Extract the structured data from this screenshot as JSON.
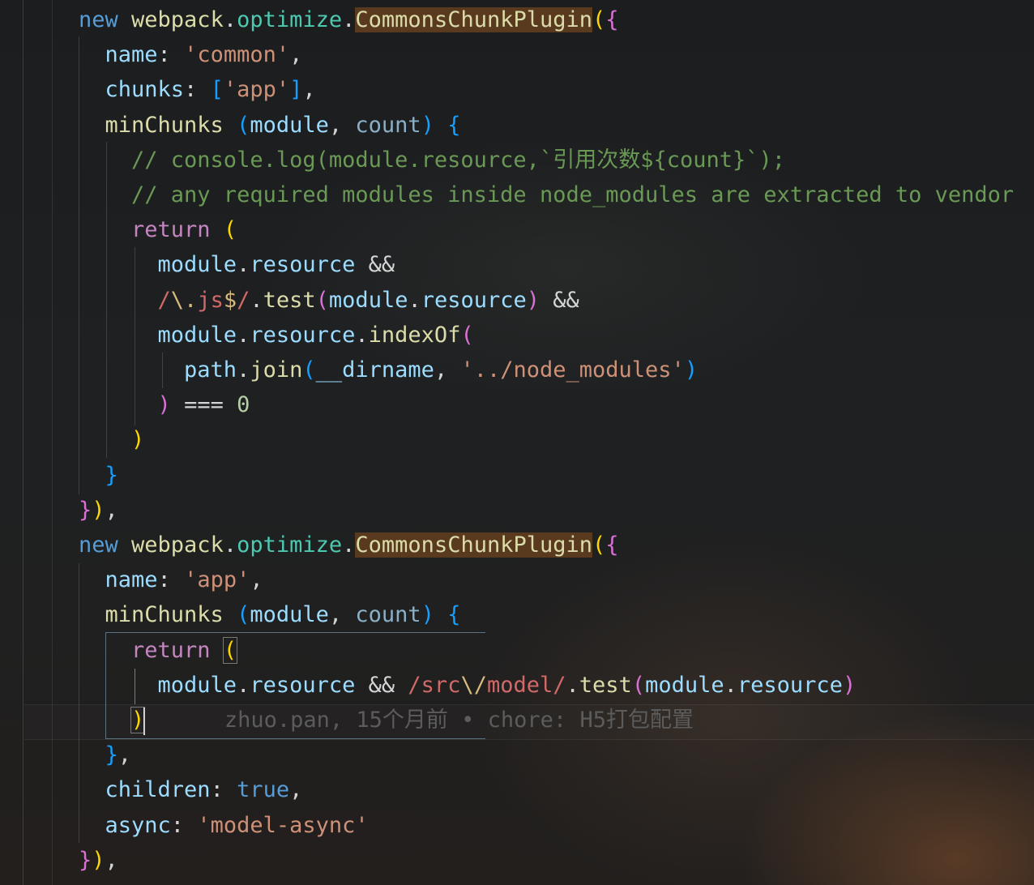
{
  "editor": {
    "language": "javascript",
    "lines": [
      [
        {
          "t": "new ",
          "c": "kw"
        },
        {
          "t": "webpack",
          "c": "fn"
        },
        {
          "t": ".",
          "c": "punc"
        },
        {
          "t": "optimize",
          "c": "cls"
        },
        {
          "t": ".",
          "c": "punc"
        },
        {
          "t": "CommonsChunkPlugin",
          "c": "fn hl"
        },
        {
          "t": "(",
          "c": "b1"
        },
        {
          "t": "{",
          "c": "b2"
        }
      ],
      [
        {
          "t": "  name",
          "c": "var"
        },
        {
          "t": ": ",
          "c": "punc"
        },
        {
          "t": "'common'",
          "c": "str"
        },
        {
          "t": ",",
          "c": "punc"
        }
      ],
      [
        {
          "t": "  chunks",
          "c": "var"
        },
        {
          "t": ": ",
          "c": "punc"
        },
        {
          "t": "[",
          "c": "b3"
        },
        {
          "t": "'app'",
          "c": "str"
        },
        {
          "t": "]",
          "c": "b3"
        },
        {
          "t": ",",
          "c": "punc"
        }
      ],
      [
        {
          "t": "  minChunks ",
          "c": "fn"
        },
        {
          "t": "(",
          "c": "b3"
        },
        {
          "t": "module",
          "c": "var"
        },
        {
          "t": ", ",
          "c": "punc"
        },
        {
          "t": "count",
          "c": "var-dim"
        },
        {
          "t": ") ",
          "c": "b3"
        },
        {
          "t": "{",
          "c": "b3"
        }
      ],
      [
        {
          "t": "    // console.log(module.resource,`引用次数${count}`);",
          "c": "cmt"
        }
      ],
      [
        {
          "t": "    // any required modules inside node_modules are extracted to vendor",
          "c": "cmt"
        }
      ],
      [
        {
          "t": "    return ",
          "c": "ctrl"
        },
        {
          "t": "(",
          "c": "b1"
        }
      ],
      [
        {
          "t": "      module",
          "c": "var"
        },
        {
          "t": ".",
          "c": "punc"
        },
        {
          "t": "resource",
          "c": "var"
        },
        {
          "t": " &&",
          "c": "punc"
        }
      ],
      [
        {
          "t": "      /",
          "c": "re"
        },
        {
          "t": "\\.",
          "c": "re-ch"
        },
        {
          "t": "js",
          "c": "re"
        },
        {
          "t": "$",
          "c": "re-ch"
        },
        {
          "t": "/",
          "c": "re"
        },
        {
          "t": ".",
          "c": "punc"
        },
        {
          "t": "test",
          "c": "fn"
        },
        {
          "t": "(",
          "c": "b2"
        },
        {
          "t": "module",
          "c": "var"
        },
        {
          "t": ".",
          "c": "punc"
        },
        {
          "t": "resource",
          "c": "var"
        },
        {
          "t": ")",
          "c": "b2"
        },
        {
          "t": " &&",
          "c": "punc"
        }
      ],
      [
        {
          "t": "      module",
          "c": "var"
        },
        {
          "t": ".",
          "c": "punc"
        },
        {
          "t": "resource",
          "c": "var"
        },
        {
          "t": ".",
          "c": "punc"
        },
        {
          "t": "indexOf",
          "c": "fn"
        },
        {
          "t": "(",
          "c": "b2"
        }
      ],
      [
        {
          "t": "        path",
          "c": "var"
        },
        {
          "t": ".",
          "c": "punc"
        },
        {
          "t": "join",
          "c": "fn"
        },
        {
          "t": "(",
          "c": "b3"
        },
        {
          "t": "__dirname",
          "c": "var"
        },
        {
          "t": ", ",
          "c": "punc"
        },
        {
          "t": "'../node_modules'",
          "c": "str"
        },
        {
          "t": ")",
          "c": "b3"
        }
      ],
      [
        {
          "t": "      ",
          "c": "punc"
        },
        {
          "t": ")",
          "c": "b2"
        },
        {
          "t": " === ",
          "c": "punc"
        },
        {
          "t": "0",
          "c": "num"
        }
      ],
      [
        {
          "t": "    ",
          "c": "punc"
        },
        {
          "t": ")",
          "c": "b1"
        }
      ],
      [
        {
          "t": "  ",
          "c": "punc"
        },
        {
          "t": "}",
          "c": "b3"
        }
      ],
      [
        {
          "t": "}",
          "c": "b2"
        },
        {
          "t": ")",
          "c": "b1"
        },
        {
          "t": ",",
          "c": "punc"
        }
      ],
      [
        {
          "t": "new ",
          "c": "kw"
        },
        {
          "t": "webpack",
          "c": "fn"
        },
        {
          "t": ".",
          "c": "punc"
        },
        {
          "t": "optimize",
          "c": "cls"
        },
        {
          "t": ".",
          "c": "punc"
        },
        {
          "t": "CommonsChunkPlugin",
          "c": "fn hl"
        },
        {
          "t": "(",
          "c": "b1"
        },
        {
          "t": "{",
          "c": "b2"
        }
      ],
      [
        {
          "t": "  name",
          "c": "var"
        },
        {
          "t": ": ",
          "c": "punc"
        },
        {
          "t": "'app'",
          "c": "str"
        },
        {
          "t": ",",
          "c": "punc"
        }
      ],
      [
        {
          "t": "  minChunks ",
          "c": "fn"
        },
        {
          "t": "(",
          "c": "b3"
        },
        {
          "t": "module",
          "c": "var"
        },
        {
          "t": ", ",
          "c": "punc"
        },
        {
          "t": "count",
          "c": "var-dim"
        },
        {
          "t": ") ",
          "c": "b3"
        },
        {
          "t": "{",
          "c": "b3"
        }
      ],
      [
        {
          "t": "    return ",
          "c": "ctrl"
        },
        {
          "t": "(",
          "c": "b1 bmatch"
        }
      ],
      [
        {
          "t": "      module",
          "c": "var"
        },
        {
          "t": ".",
          "c": "punc"
        },
        {
          "t": "resource",
          "c": "var"
        },
        {
          "t": " && ",
          "c": "punc"
        },
        {
          "t": "/src",
          "c": "re"
        },
        {
          "t": "\\/",
          "c": "re-ch"
        },
        {
          "t": "model/",
          "c": "re"
        },
        {
          "t": ".",
          "c": "punc"
        },
        {
          "t": "test",
          "c": "fn"
        },
        {
          "t": "(",
          "c": "b2"
        },
        {
          "t": "module",
          "c": "var"
        },
        {
          "t": ".",
          "c": "punc"
        },
        {
          "t": "resource",
          "c": "var"
        },
        {
          "t": ")",
          "c": "b2"
        }
      ],
      [
        {
          "t": "    ",
          "c": "punc"
        },
        {
          "t": ")",
          "c": "b1 bmatch"
        },
        {
          "t": "CURSOR",
          "c": "cursor"
        },
        {
          "t": "      zhuo.pan, 15个月前 • chore: H5打包配置",
          "c": "blame"
        }
      ],
      [
        {
          "t": "  ",
          "c": "punc"
        },
        {
          "t": "}",
          "c": "b3"
        },
        {
          "t": ",",
          "c": "punc"
        }
      ],
      [
        {
          "t": "  children",
          "c": "var"
        },
        {
          "t": ": ",
          "c": "punc"
        },
        {
          "t": "true",
          "c": "kw"
        },
        {
          "t": ",",
          "c": "punc"
        }
      ],
      [
        {
          "t": "  async",
          "c": "var"
        },
        {
          "t": ": ",
          "c": "punc"
        },
        {
          "t": "'model-async'",
          "c": "str"
        }
      ],
      [
        {
          "t": "}",
          "c": "b2"
        },
        {
          "t": ")",
          "c": "b1"
        },
        {
          "t": ",",
          "c": "punc"
        }
      ]
    ]
  },
  "git_blame": {
    "author": "zhuo.pan",
    "time": "15个月前",
    "message": "chore: H5打包配置"
  }
}
